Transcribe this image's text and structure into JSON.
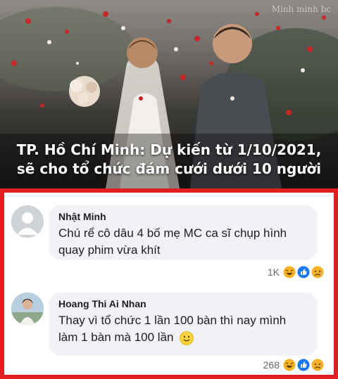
{
  "photo": {
    "watermark": "Minh minh bc",
    "headline_line1": "TP. Hồ Chí Minh: Dự kiến từ 1/10/2021,",
    "headline_line2": "sẽ cho tổ chức đám cưới dưới 10 người"
  },
  "comments": [
    {
      "author": "Nhật Minh",
      "text": "Chú rể cô dâu 4 bố mẹ MC ca sĩ chụp hình quay phim vừa khít",
      "reaction_count": "1K"
    },
    {
      "author": "Hoang Thi Ai Nhan",
      "text": "Thay vì tổ chức 1 lần 100 bàn thì nay mình làm 1 bàn mà 100 lần",
      "reaction_count": "268"
    }
  ],
  "colors": {
    "frame": "#e02020",
    "bubble": "#f0f2f5",
    "like": "#1877f2",
    "haha": "#f7b125"
  },
  "icons": [
    "haha-icon",
    "like-icon",
    "sad-icon",
    "smile-emoji-icon",
    "default-avatar-icon"
  ]
}
